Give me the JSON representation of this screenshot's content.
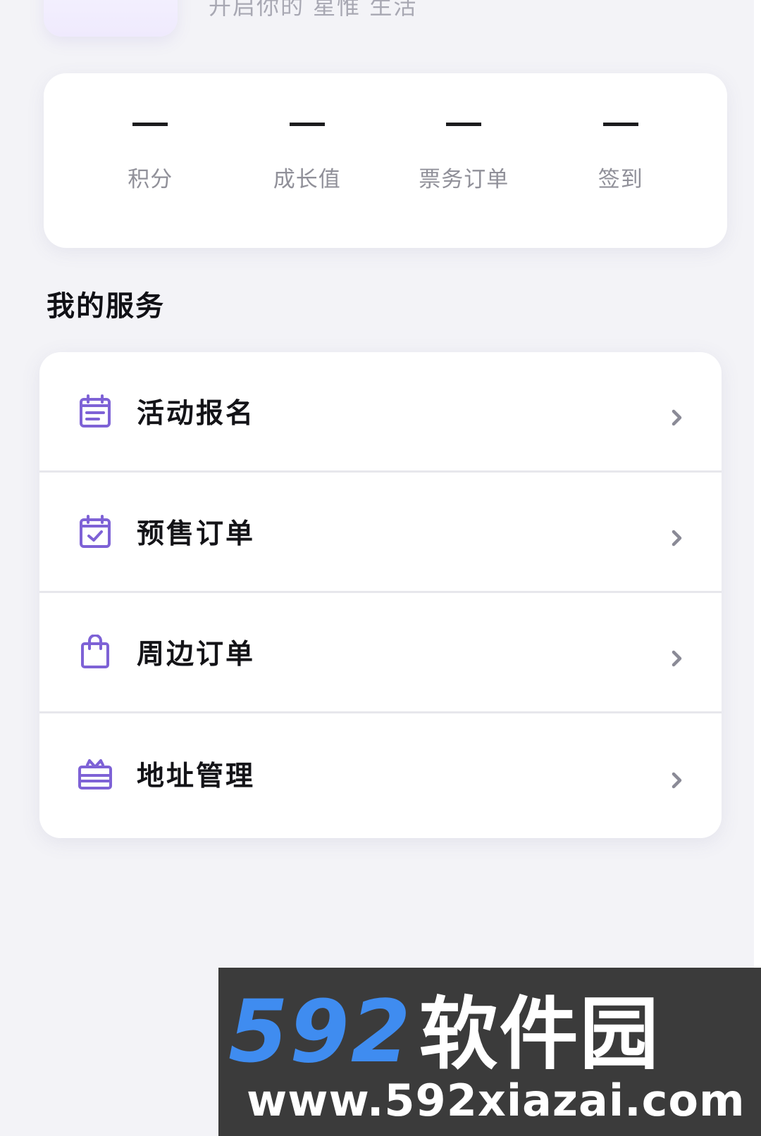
{
  "header": {
    "tagline": "开启你的 星惟 生活"
  },
  "stats": [
    {
      "value": "—",
      "label": "积分"
    },
    {
      "value": "—",
      "label": "成长值"
    },
    {
      "value": "—",
      "label": "票务订单"
    },
    {
      "value": "—",
      "label": "签到"
    }
  ],
  "services": {
    "title": "我的服务",
    "items": [
      {
        "label": "活动报名",
        "icon": "document-icon"
      },
      {
        "label": "预售订单",
        "icon": "calendar-check-icon"
      },
      {
        "label": "周边订单",
        "icon": "shopping-bag-icon"
      },
      {
        "label": "地址管理",
        "icon": "gift-box-icon"
      }
    ]
  },
  "colors": {
    "accent": "#7e62d6",
    "background": "#f3f3f7"
  },
  "watermark": {
    "brand_number": "592",
    "brand_name": "软件园",
    "url": "www.592xiazai.com"
  }
}
